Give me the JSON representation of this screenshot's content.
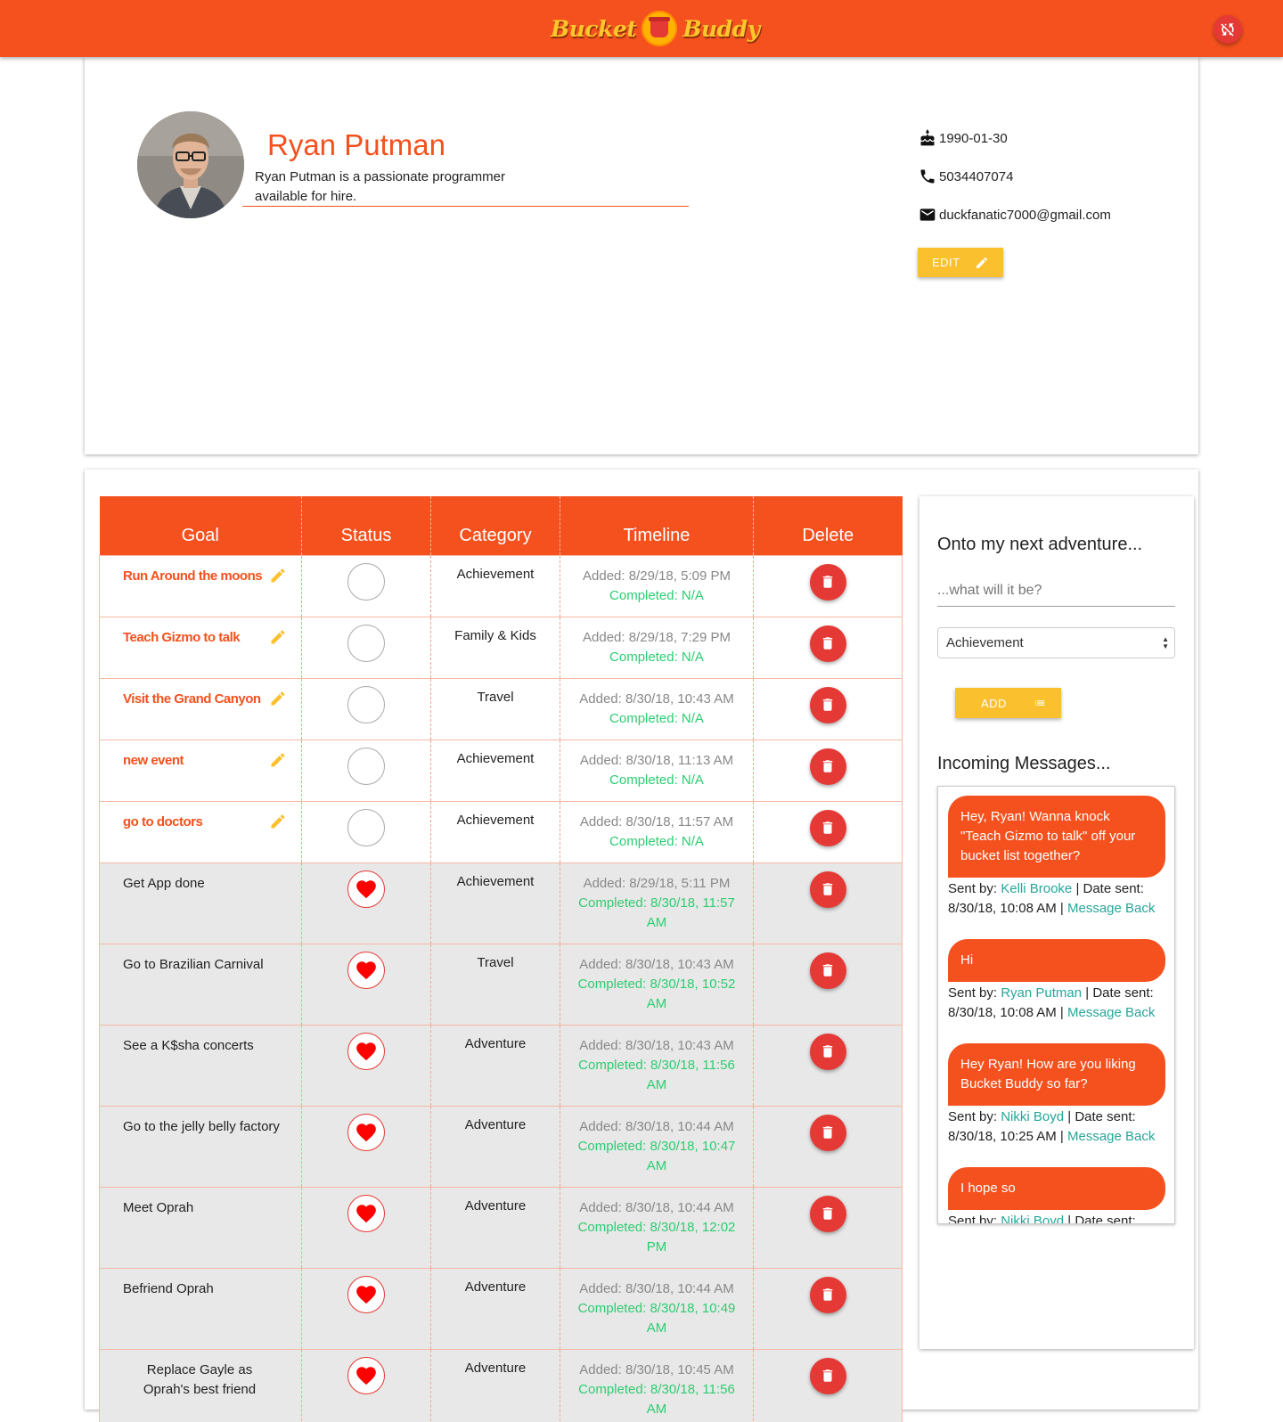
{
  "header": {
    "logo_left": "Bucket",
    "logo_right": "Buddy"
  },
  "profile": {
    "name": "Ryan Putman",
    "bio": "Ryan Putman is a passionate programmer available for hire.",
    "birthday": "1990-01-30",
    "phone": "5034407074",
    "email": "duckfanatic7000@gmail.com",
    "edit_label": "EDIT"
  },
  "table": {
    "headers": [
      "Goal",
      "Status",
      "Category",
      "Timeline",
      "Delete"
    ],
    "rows": [
      {
        "goal": "Run Around the moons",
        "category": "Achievement",
        "added": "Added: 8/29/18, 5:09 PM",
        "completed": "Completed: N/A",
        "done": false
      },
      {
        "goal": "Teach Gizmo to talk",
        "category": "Family & Kids",
        "added": "Added: 8/29/18, 7:29 PM",
        "completed": "Completed: N/A",
        "done": false
      },
      {
        "goal": "Visit the Grand Canyon",
        "category": "Travel",
        "added": "Added: 8/30/18, 10:43 AM",
        "completed": "Completed: N/A",
        "done": false
      },
      {
        "goal": "new event",
        "category": "Achievement",
        "added": "Added: 8/30/18, 11:13 AM",
        "completed": "Completed: N/A",
        "done": false
      },
      {
        "goal": "go to doctors",
        "category": "Achievement",
        "added": "Added: 8/30/18, 11:57 AM",
        "completed": "Completed: N/A",
        "done": false
      },
      {
        "goal": "Get App done",
        "category": "Achievement",
        "added": "Added: 8/29/18, 5:11 PM",
        "completed": "Completed: 8/30/18, 11:57 AM",
        "done": true
      },
      {
        "goal": "Go to Brazilian Carnival",
        "category": "Travel",
        "added": "Added: 8/30/18, 10:43 AM",
        "completed": "Completed: 8/30/18, 10:52 AM",
        "done": true
      },
      {
        "goal": "See a K$sha concerts",
        "category": "Adventure",
        "added": "Added: 8/30/18, 10:43 AM",
        "completed": "Completed: 8/30/18, 11:56 AM",
        "done": true
      },
      {
        "goal": "Go to the jelly belly factory",
        "category": "Adventure",
        "added": "Added: 8/30/18, 10:44 AM",
        "completed": "Completed: 8/30/18, 10:47 AM",
        "done": true
      },
      {
        "goal": "Meet Oprah",
        "category": "Adventure",
        "added": "Added: 8/30/18, 10:44 AM",
        "completed": "Completed: 8/30/18, 12:02 PM",
        "done": true
      },
      {
        "goal": "Befriend Oprah",
        "category": "Adventure",
        "added": "Added: 8/30/18, 10:44 AM",
        "completed": "Completed: 8/30/18, 10:49 AM",
        "done": true
      },
      {
        "goal": "Replace Gayle as Oprah's best friend",
        "category": "Adventure",
        "added": "Added: 8/30/18, 10:45 AM",
        "completed": "Completed: 8/30/18, 11:56 AM",
        "done": true
      }
    ]
  },
  "side": {
    "title": "Onto my next adventure...",
    "input_placeholder": "...what will it be?",
    "category_selected": "Achievement",
    "add_label": "ADD",
    "messages_title": "Incoming Messages..."
  },
  "messages": [
    {
      "text": "Hey, Ryan! Wanna knock \"Teach Gizmo to talk\" off your bucket list together?",
      "sent_by_label": "Sent by:",
      "sender": "Kelli Brooke",
      "date_label": "| Date sent:",
      "date": "8/30/18, 10:08 AM |",
      "reply": "Message Back"
    },
    {
      "text": "Hi",
      "sent_by_label": "Sent by:",
      "sender": "Ryan Putman",
      "date_label": "| Date sent:",
      "date": "8/30/18, 10:08 AM |",
      "reply": "Message Back"
    },
    {
      "text": "Hey Ryan! How are you liking Bucket Buddy so far?",
      "sent_by_label": "Sent by:",
      "sender": "Nikki Boyd",
      "date_label": "| Date sent:",
      "date": "8/30/18, 10:25 AM |",
      "reply": "Message Back"
    },
    {
      "text": "I hope so",
      "sent_by_label": "Sent by:",
      "sender": "Nikki Boyd",
      "date_label": "| Date sent:",
      "date": "",
      "reply": ""
    }
  ],
  "colors": {
    "primary": "#f4511e",
    "accent": "#fbc02d",
    "danger": "#e53935",
    "success": "#2ecc71",
    "link": "#26a69a"
  }
}
